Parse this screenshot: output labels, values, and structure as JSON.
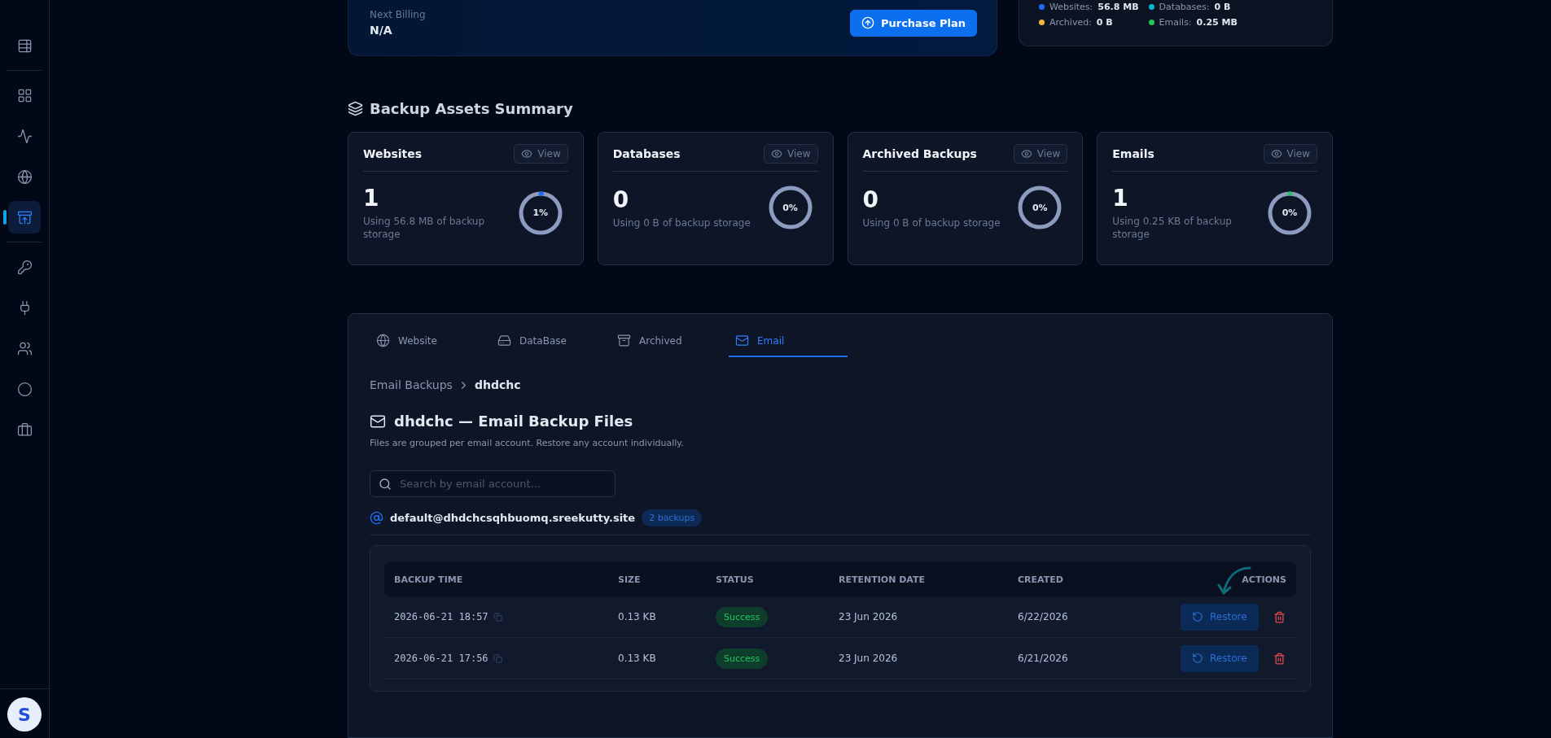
{
  "sidebar": {
    "items": [
      {
        "selected": false
      },
      {
        "selected": false
      },
      {
        "selected": false
      },
      {
        "selected": false
      },
      {
        "selected": true
      },
      {
        "selected": false
      },
      {
        "selected": false
      },
      {
        "selected": false
      },
      {
        "selected": false
      },
      {
        "selected": false
      }
    ],
    "avatar": "S"
  },
  "plan": {
    "billing_label": "Next Billing",
    "billing_value": "N/A",
    "button": "Purchase Plan"
  },
  "usage_legend": [
    {
      "label": "Websites:",
      "value": "56.8 MB",
      "color": "#1d6ff2"
    },
    {
      "label": "Databases:",
      "value": "0 B",
      "color": "#06b6d4"
    },
    {
      "label": "Archived:",
      "value": "0 B",
      "color": "#f5b73b"
    },
    {
      "label": "Emails:",
      "value": "0.25 MB",
      "color": "#22c55e"
    }
  ],
  "summary": {
    "title": "Backup Assets Summary",
    "cards": [
      {
        "title": "Websites",
        "view": "View",
        "count": "1",
        "usage": "Using 56.8 MB of backup storage",
        "percent": "1%",
        "level": 0.01,
        "color": "#1d6ff2"
      },
      {
        "title": "Databases",
        "view": "View",
        "count": "0",
        "usage": "Using 0 B of backup storage",
        "percent": "0%"
      },
      {
        "title": "Archived Backups",
        "view": "View",
        "count": "0",
        "usage": "Using 0 B of backup storage",
        "percent": "0%"
      },
      {
        "title": "Emails",
        "view": "View",
        "count": "1",
        "usage": "Using 0.25 KB of backup storage",
        "percent": "0%",
        "level": 0.004,
        "color": "#22c55e"
      }
    ]
  },
  "tabs": [
    {
      "label": "Website",
      "selected": false
    },
    {
      "label": "DataBase",
      "selected": false
    },
    {
      "label": "Archived",
      "selected": false
    },
    {
      "label": "Email",
      "selected": true
    }
  ],
  "breadcrumb": [
    "Email Backups",
    "dhdchc"
  ],
  "heading": "dhdchc — Email Backup Files",
  "subtitle": "Files are grouped per email account. Restore any account individually.",
  "search": {
    "placeholder": "Search by email account..."
  },
  "account": {
    "email": "default@dhdchcsqhbuomq.sreekutty.site",
    "badge": "2 backups"
  },
  "table": {
    "columns": [
      "BACKUP TIME",
      "SIZE",
      "STATUS",
      "RETENTION DATE",
      "CREATED",
      "ACTIONS"
    ],
    "rows": [
      {
        "time": "2026-06-21 18:57",
        "size": "0.13 KB",
        "status": "Success",
        "retention": "23 Jun 2026",
        "created": "6/22/2026",
        "action": "Restore"
      },
      {
        "time": "2026-06-21 17:56",
        "size": "0.13 KB",
        "status": "Success",
        "retention": "23 Jun 2026",
        "created": "6/21/2026",
        "action": "Restore"
      }
    ]
  }
}
